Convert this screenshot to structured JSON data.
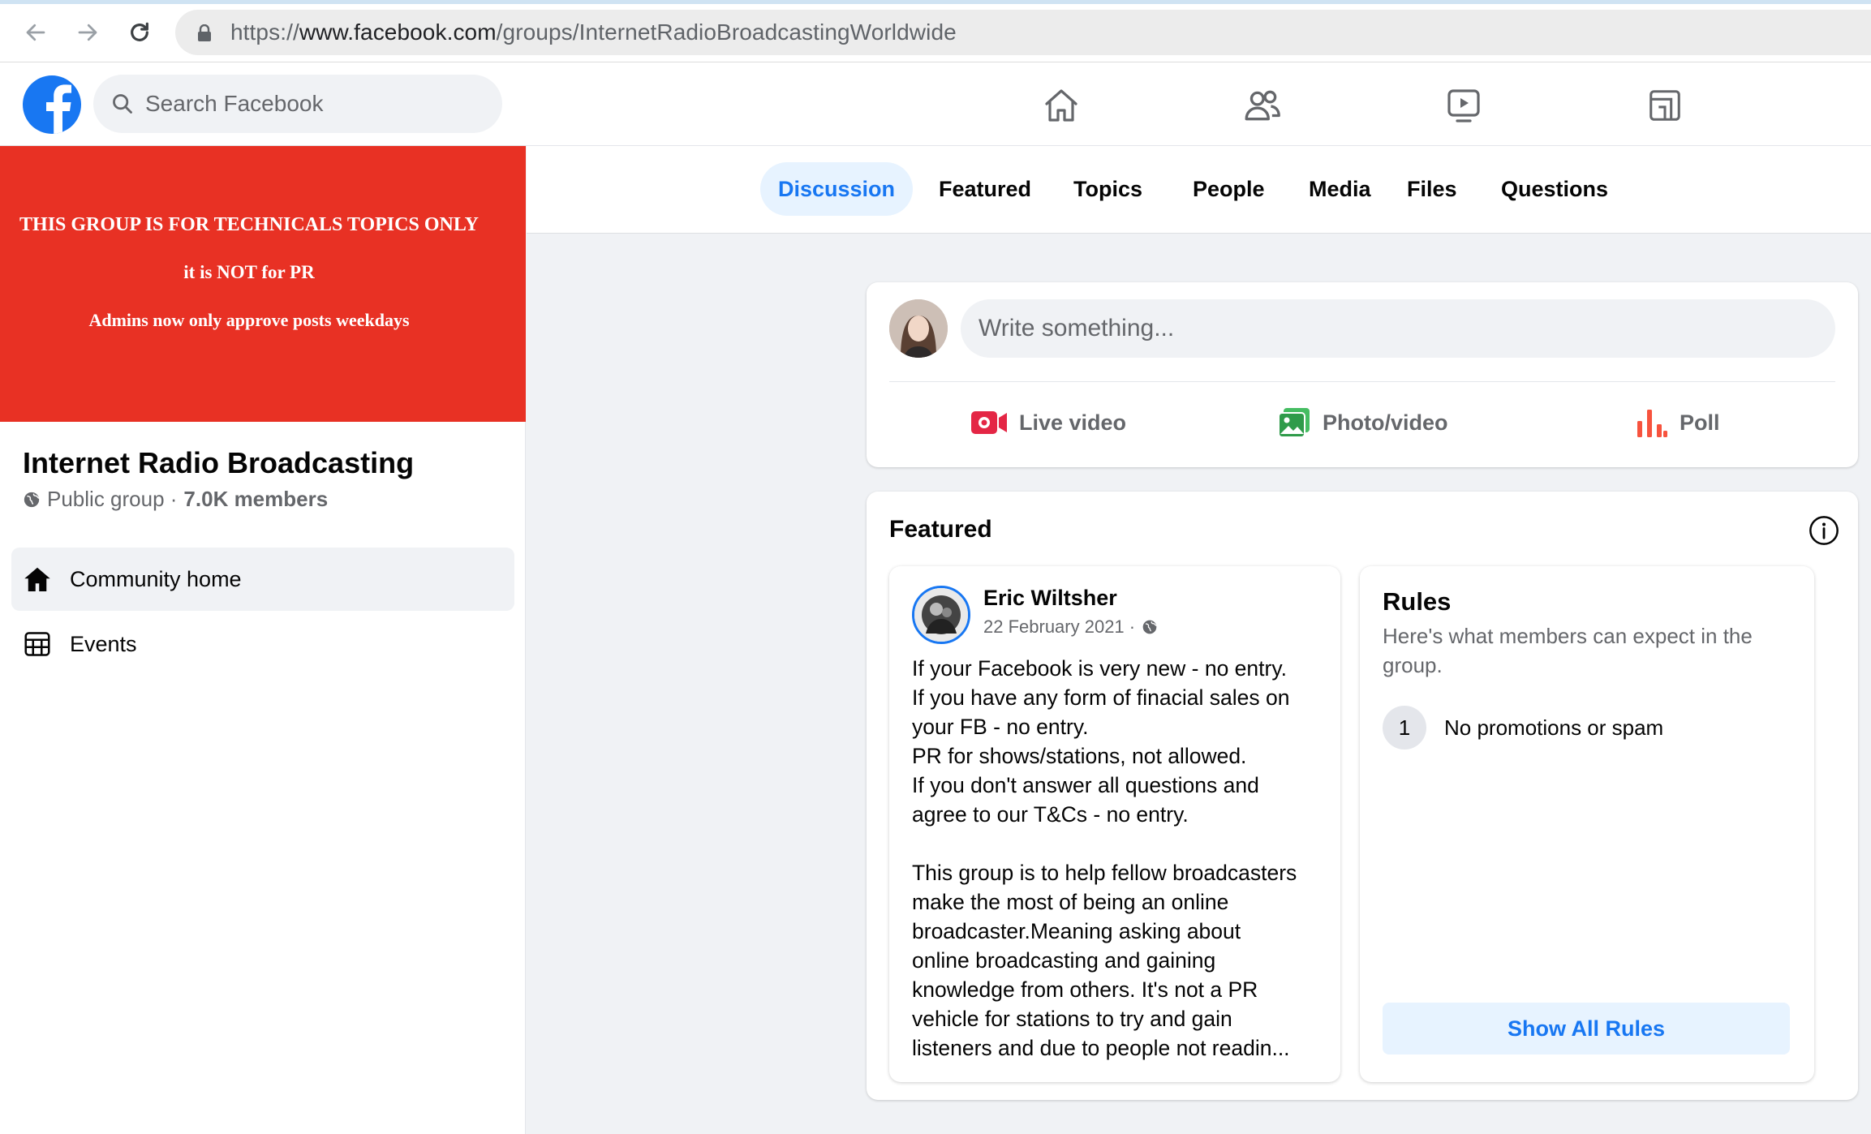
{
  "browser": {
    "url_prefix": "https://",
    "url_host": "www.facebook.com",
    "url_path": "/groups/InternetRadioBroadcastingWorldwide"
  },
  "header": {
    "search_placeholder": "Search Facebook",
    "nav_icons": [
      "home-icon",
      "friends-icon",
      "watch-icon",
      "gaming-icon"
    ]
  },
  "cover": {
    "line1": "THIS GROUP IS FOR TECHNICALS TOPICS ONLY",
    "line2": "it is NOT for PR",
    "line3": "Admins now only approve posts weekdays"
  },
  "group": {
    "name": "Internet Radio Broadcasting",
    "privacy": "Public group ·",
    "members": "7.0K members"
  },
  "sidebar": {
    "items": [
      {
        "label": "Community home",
        "icon": "home-filled-icon",
        "active": true
      },
      {
        "label": "Events",
        "icon": "calendar-icon",
        "active": false
      }
    ]
  },
  "tabs": [
    {
      "label": "Discussion",
      "active": true
    },
    {
      "label": "Featured"
    },
    {
      "label": "Topics"
    },
    {
      "label": "People"
    },
    {
      "label": "Media"
    },
    {
      "label": "Files"
    },
    {
      "label": "Questions"
    }
  ],
  "composer": {
    "placeholder": "Write something...",
    "live_video": "Live video",
    "photo_video": "Photo/video",
    "poll": "Poll"
  },
  "featured": {
    "title": "Featured",
    "post": {
      "author": "Eric Wiltsher",
      "date": "22 February 2021 ·",
      "lines": [
        "If your Facebook is very new - no entry.",
        "If you have any form of finacial sales on",
        "your FB - no entry.",
        "PR for shows/stations, not allowed.",
        "If you don't answer all questions and",
        "agree to our T&Cs - no entry.",
        "",
        "This group is to help fellow broadcasters",
        "make the most of being an online",
        "broadcaster.Meaning asking about",
        "online broadcasting and gaining",
        "knowledge from others. It's not a PR",
        "vehicle for stations to try and gain",
        "listeners and due to people not readin..."
      ]
    },
    "rules": {
      "title": "Rules",
      "subtitle": "Here's what members can expect in the group.",
      "items": [
        {
          "number": "1",
          "text": "No promotions or spam"
        }
      ],
      "show_all": "Show All Rules"
    }
  },
  "colors": {
    "brand_blue": "#1877f2",
    "cover_red": "#e83124",
    "live_red": "#e42645",
    "photo_green": "#45bd62",
    "poll_orange": "#f7533e"
  }
}
